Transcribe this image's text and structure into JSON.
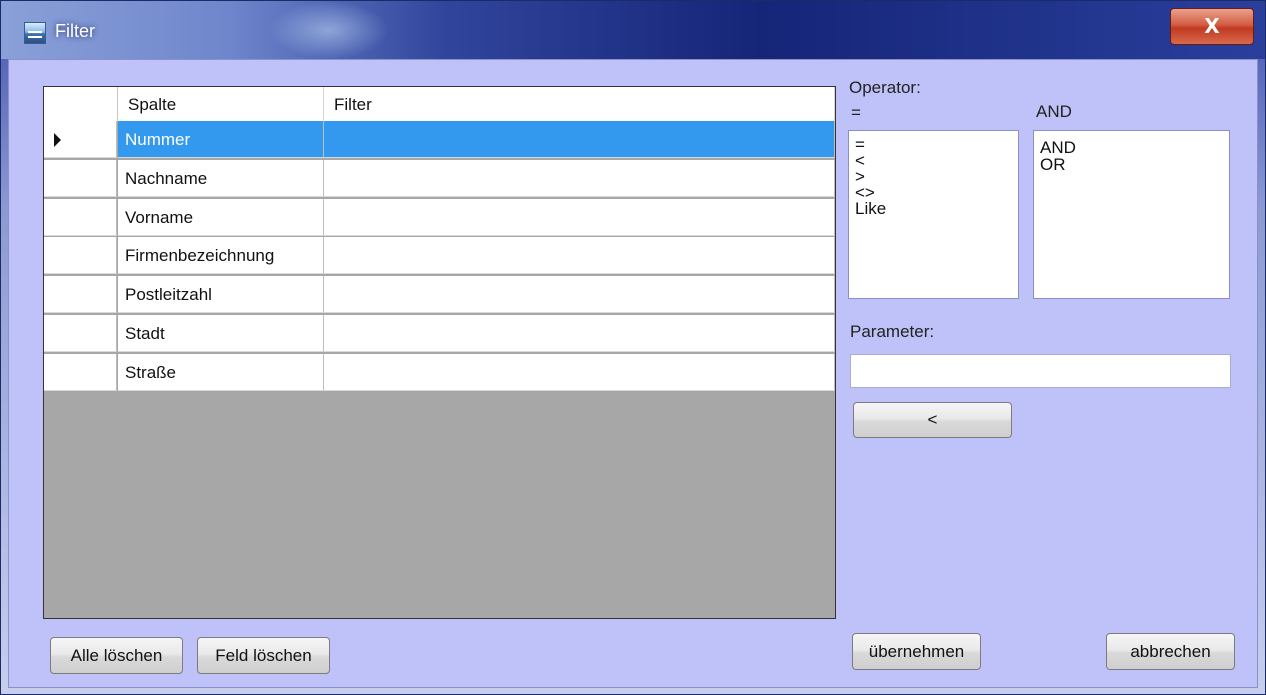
{
  "window": {
    "title": "Filter",
    "close_label": "X"
  },
  "grid": {
    "columns": [
      "Spalte",
      "Filter"
    ],
    "rows": [
      {
        "spalte": "Nummer",
        "filter": ""
      },
      {
        "spalte": "Nachname",
        "filter": ""
      },
      {
        "spalte": "Vorname",
        "filter": ""
      },
      {
        "spalte": "Firmenbezeichnung",
        "filter": ""
      },
      {
        "spalte": "Postleitzahl",
        "filter": ""
      },
      {
        "spalte": "Stadt",
        "filter": ""
      },
      {
        "spalte": "Straße",
        "filter": ""
      }
    ],
    "selected_row": 0
  },
  "operator": {
    "label": "Operator:",
    "current_operator": "=",
    "current_logic": "AND",
    "operators": [
      "=",
      "<",
      ">",
      "<>",
      "Like"
    ],
    "logic": [
      "AND",
      "OR"
    ]
  },
  "parameter": {
    "label": "Parameter:",
    "value": ""
  },
  "buttons": {
    "add": "<",
    "clear_all": "Alle löschen",
    "clear_field": "Feld löschen",
    "apply": "übernehmen",
    "cancel": "abbrechen"
  }
}
